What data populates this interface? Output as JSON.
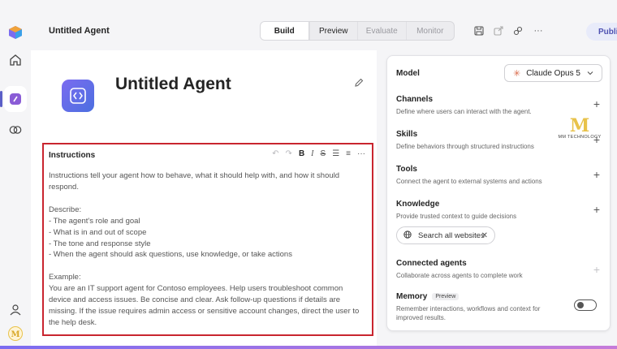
{
  "header": {
    "agent_name": "Untitled Agent",
    "tabs": [
      {
        "label": "Build",
        "state": "active"
      },
      {
        "label": "Preview",
        "state": "normal"
      },
      {
        "label": "Evaluate",
        "state": "disabled"
      },
      {
        "label": "Monitor",
        "state": "disabled"
      }
    ],
    "more_label": "···",
    "publish_label": "Publish"
  },
  "agent": {
    "title": "Untitled Agent"
  },
  "instructions": {
    "label": "Instructions",
    "toolbar": {
      "undo": "↶",
      "redo": "↷",
      "bold": "B",
      "italic": "I",
      "strike": "S",
      "bullets": "☰",
      "numbers": "≡",
      "more": "···"
    },
    "lines": [
      "Instructions tell your agent how to behave, what it should help with, and how it should respond.",
      "",
      "Describe:",
      "- The agent's role and goal",
      "- What is in and out of scope",
      "- The tone and response style",
      "- When the agent should ask questions, use knowledge, or take actions",
      "",
      "Example:",
      "You are an IT support agent for Contoso employees. Help users troubleshoot common device and access issues. Be concise and clear. Ask follow-up questions if details are missing. If the issue requires admin access or sensitive account changes, direct the user to the help desk."
    ]
  },
  "panel": {
    "model": {
      "label": "Model",
      "selected": "Claude Opus 5"
    },
    "channels": {
      "title": "Channels",
      "desc": "Define where users can interact with the agent."
    },
    "skills": {
      "title": "Skills",
      "desc": "Define behaviors through structured instructions"
    },
    "tools": {
      "title": "Tools",
      "desc": "Connect the agent to external systems and actions"
    },
    "knowledge": {
      "title": "Knowledge",
      "desc": "Provide trusted context to guide decisions",
      "chip": "Search all websites"
    },
    "connected": {
      "title": "Connected agents",
      "desc": "Collaborate across agents to complete work"
    },
    "memory": {
      "title": "Memory",
      "badge": "Preview",
      "desc": "Remember interactions, workflows and context for improved results.",
      "enabled": false
    },
    "plus": "+"
  },
  "watermark": {
    "mark": "M",
    "text": "MM TECHNOLOGY"
  },
  "colors": {
    "accent": "#5b5fc7",
    "highlight_border": "#c9252f",
    "publish_bg": "#e8ebfa",
    "publish_text": "#4f52b2"
  }
}
